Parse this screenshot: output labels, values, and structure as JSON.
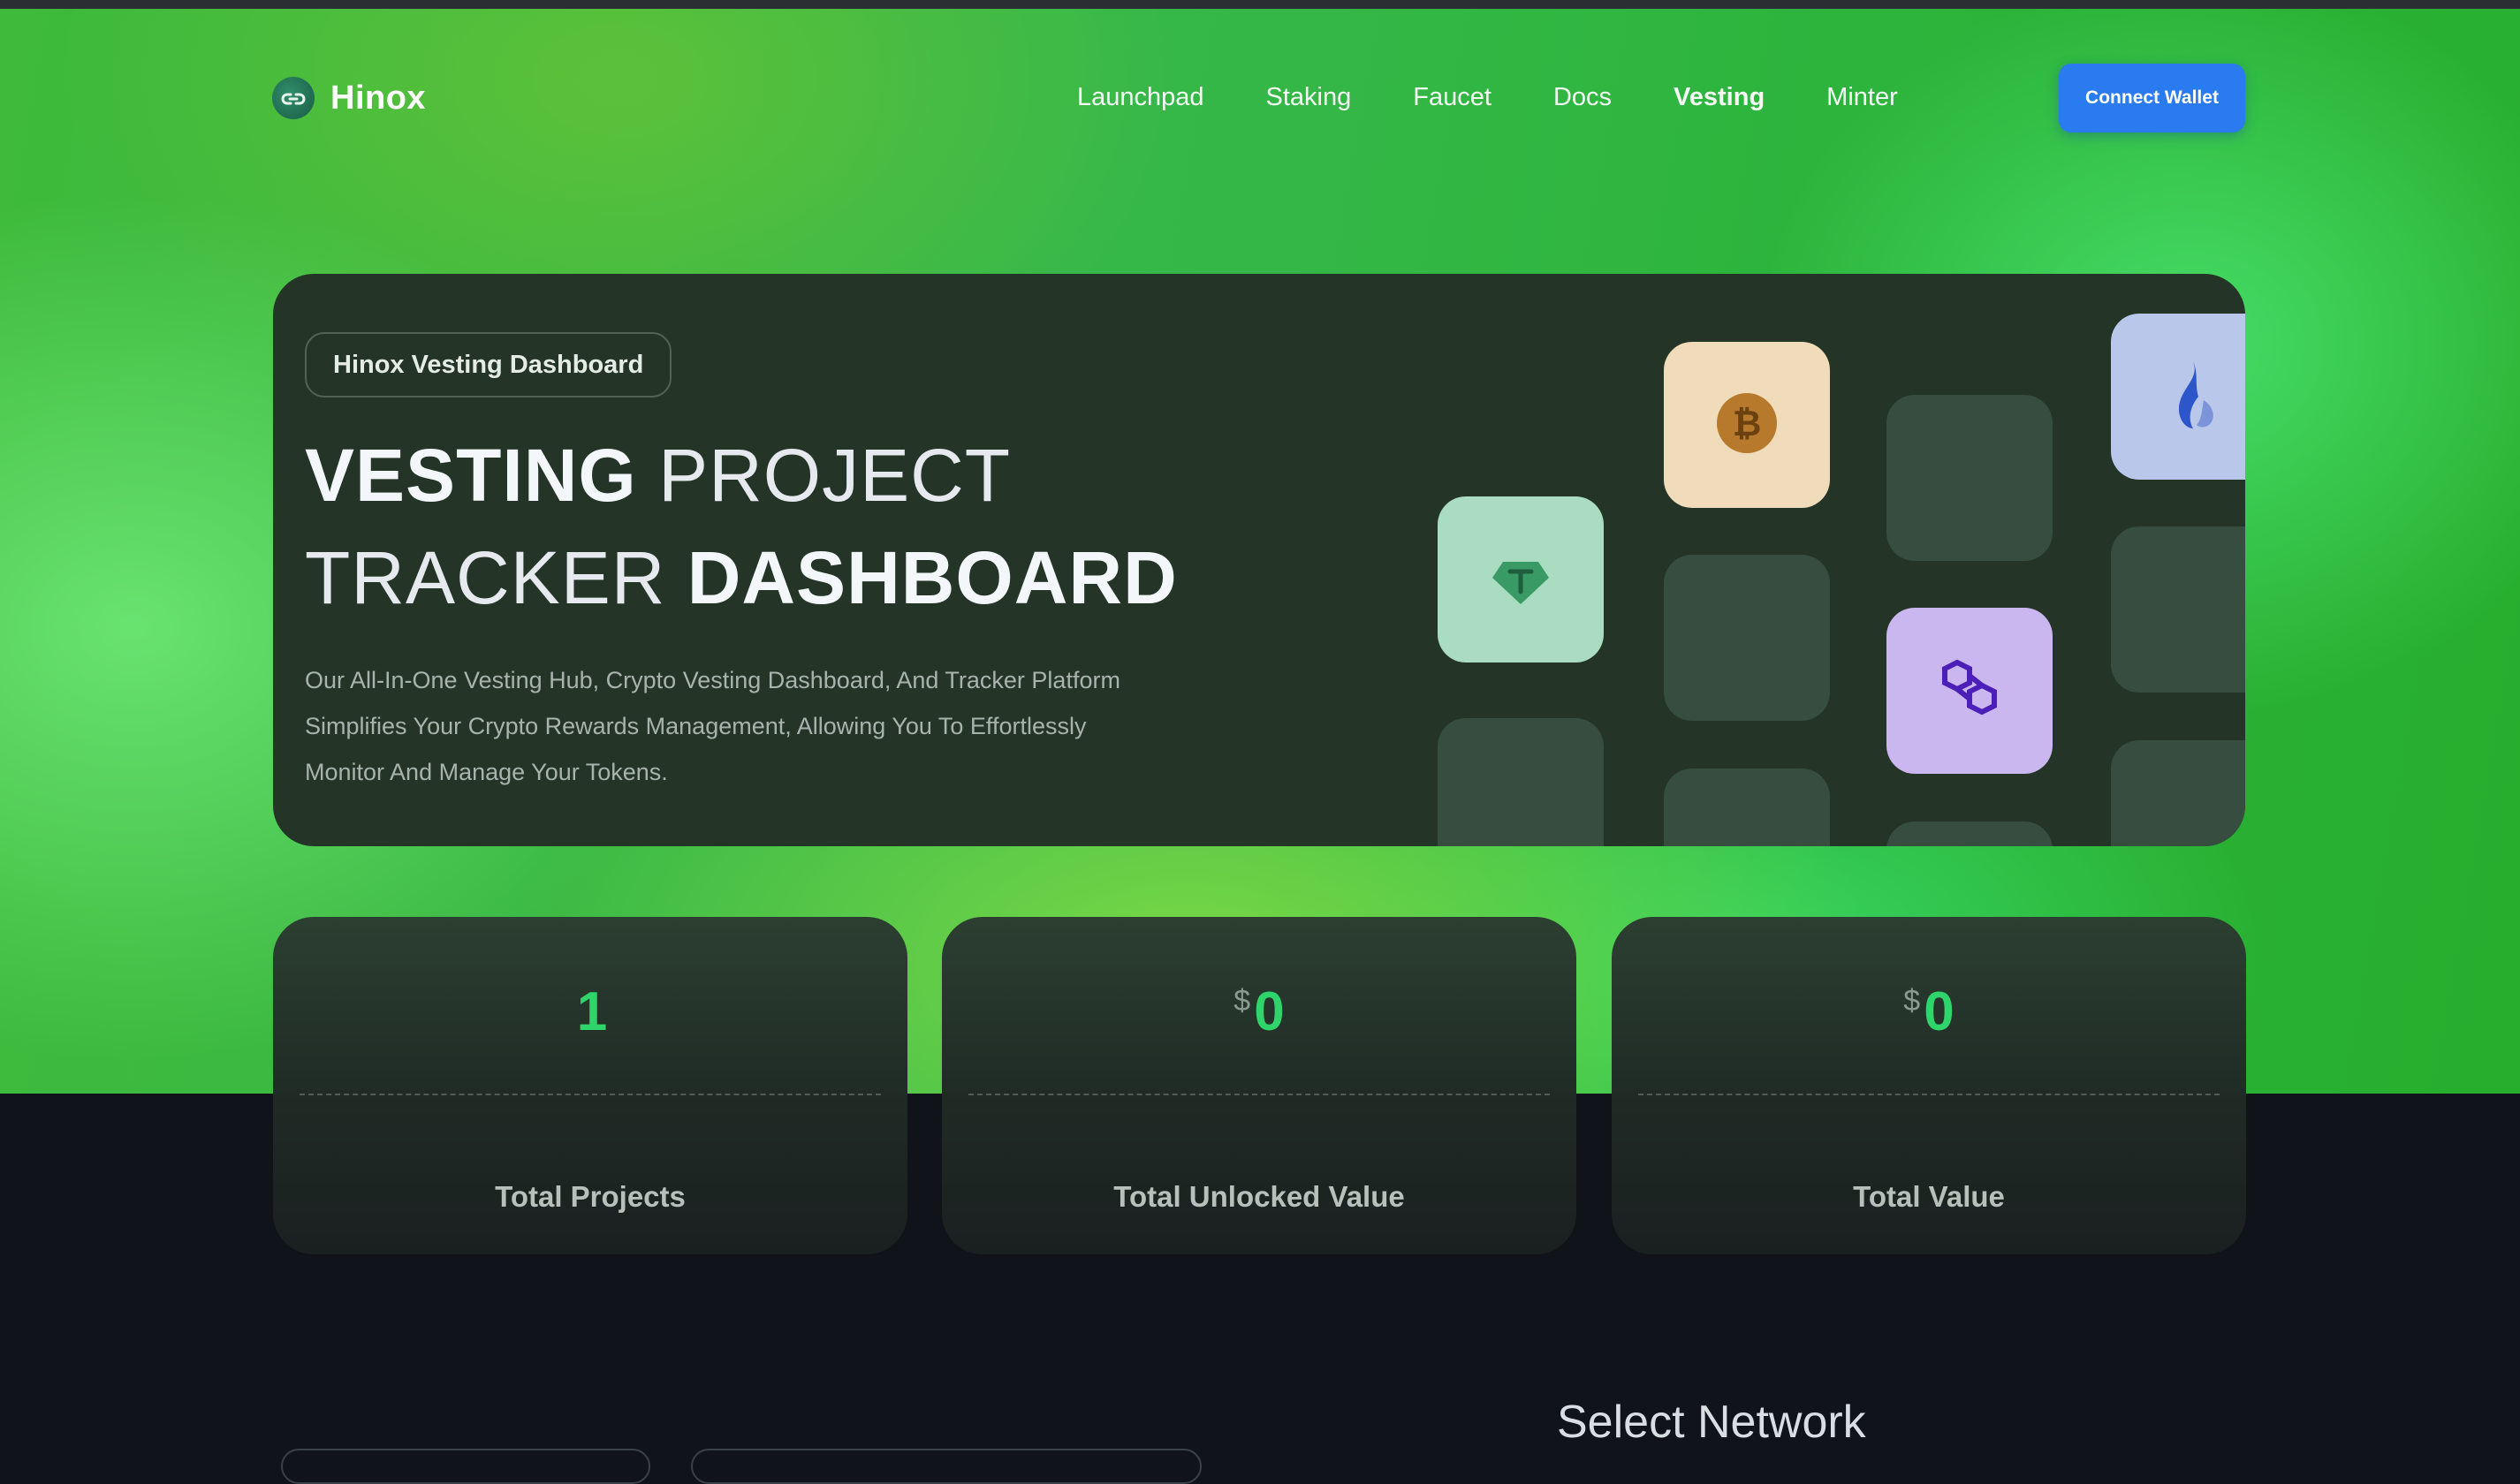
{
  "brand": {
    "name": "Hinox",
    "logo_icon": "link-icon"
  },
  "nav": {
    "items": [
      {
        "label": "Launchpad",
        "active": false
      },
      {
        "label": "Staking",
        "active": false
      },
      {
        "label": "Faucet",
        "active": false
      },
      {
        "label": "Docs",
        "active": false
      },
      {
        "label": "Vesting",
        "active": true
      },
      {
        "label": "Minter",
        "active": false
      }
    ],
    "connect_label": "Connect Wallet"
  },
  "hero": {
    "badge": "Hinox Vesting Dashboard",
    "title_line1_bold": "VESTING",
    "title_line1_light": "PROJECT",
    "title_line2_light": "TRACKER",
    "title_line2_bold": "DASHBOARD",
    "description": "Our All-In-One Vesting Hub, Crypto Vesting Dashboard, And Tracker Platform Simplifies Your Crypto Rewards Management, Allowing You To Effortlessly Monitor And Manage Your Tokens.",
    "icons": [
      "tether-icon",
      "bitcoin-icon",
      "polygon-icon",
      "flame-icon"
    ]
  },
  "stats": [
    {
      "prefix": "",
      "value": "1",
      "label": "Total Projects"
    },
    {
      "prefix": "$",
      "value": "0",
      "label": "Total Unlocked Value"
    },
    {
      "prefix": "$",
      "value": "0",
      "label": "Total Value"
    }
  ],
  "section": {
    "select_network": "Select Network"
  },
  "colors": {
    "accent_green": "#2fd46a",
    "button_blue": "#2a7bf0",
    "card_bg": "#243528",
    "page_dark": "#10141a"
  }
}
